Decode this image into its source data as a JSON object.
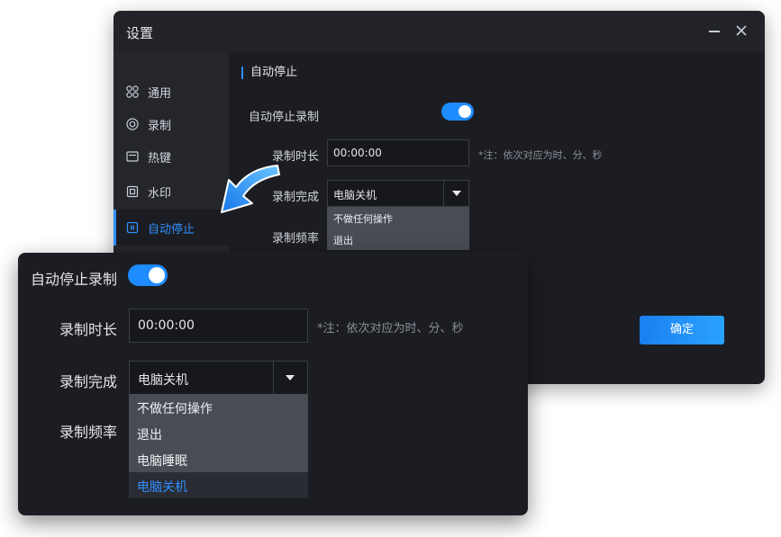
{
  "window": {
    "title": "设置"
  },
  "sidebar": {
    "items": [
      {
        "label": "通用",
        "icon": "grid-icon"
      },
      {
        "label": "录制",
        "icon": "record-icon"
      },
      {
        "label": "热键",
        "icon": "keyboard-icon"
      },
      {
        "label": "水印",
        "icon": "watermark-icon"
      },
      {
        "label": "自动停止",
        "icon": "auto-stop-icon",
        "active": true
      }
    ]
  },
  "auto_stop": {
    "section_title": "自动停止",
    "enable_label": "自动停止录制",
    "enabled": true,
    "duration_label": "录制时长",
    "duration_value": "00:00:00",
    "duration_note": "*注：依次对应为时、分、秒",
    "finish_label": "录制完成",
    "finish_value": "电脑关机",
    "frequency_label": "录制频率",
    "confirm_label": "确定"
  },
  "finish_options_small": [
    "不做任何操作",
    "退出"
  ],
  "finish_options_full": [
    "不做任何操作",
    "退出",
    "电脑睡眠",
    "电脑关机"
  ],
  "colors": {
    "accent": "#2f8fff",
    "window_bg": "#1c1d22",
    "sidebar_bg": "#25262c",
    "dropdown_bg": "#4a4c54"
  }
}
